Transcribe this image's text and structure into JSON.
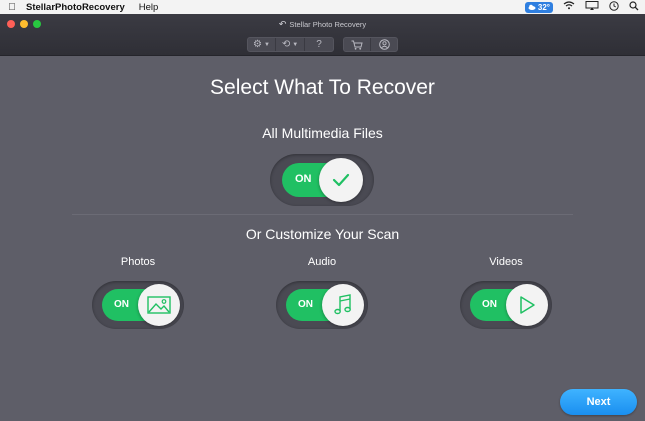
{
  "menubar": {
    "app_name": "StellarPhotoRecovery",
    "help": "Help",
    "badge_value": "32°"
  },
  "window": {
    "title": "Stellar Photo Recovery",
    "toolbar": {
      "help_glyph": "?"
    }
  },
  "main": {
    "heading": "Select What To Recover",
    "all_multimedia": {
      "label": "All Multimedia Files",
      "toggle_text": "ON",
      "state": "on"
    },
    "customize_heading": "Or Customize Your Scan",
    "categories": [
      {
        "label": "Photos",
        "toggle_text": "ON",
        "icon": "image-icon"
      },
      {
        "label": "Audio",
        "toggle_text": "ON",
        "icon": "music-note-icon"
      },
      {
        "label": "Videos",
        "toggle_text": "ON",
        "icon": "play-icon"
      }
    ],
    "next_label": "Next"
  },
  "colors": {
    "accent_green": "#20c063",
    "next_blue": "#1a8ff0",
    "background": "#5e5e68"
  }
}
